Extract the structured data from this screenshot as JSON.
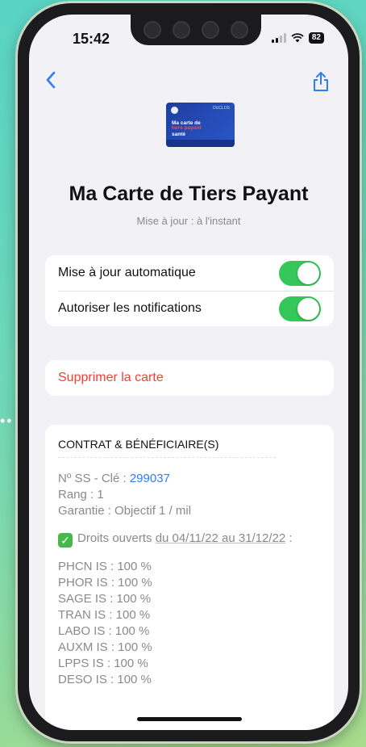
{
  "status_bar": {
    "time": "15:42",
    "battery": "82"
  },
  "nav": {
    "back_icon": "chevron-left-icon",
    "share_icon": "share-icon"
  },
  "card": {
    "logo": "DUCLOS",
    "line1": "Ma carte de",
    "line2": "tiers payant",
    "line3": "santé",
    "title": "Ma Carte de Tiers Payant",
    "subtitle": "Mise à jour : à l'instant"
  },
  "settings": {
    "auto_update": {
      "label": "Mise à jour automatique",
      "enabled": true
    },
    "notifications": {
      "label": "Autoriser les notifications",
      "enabled": true
    }
  },
  "delete": {
    "label": "Supprimer la carte"
  },
  "details": {
    "header": "CONTRAT & BÉNÉFICIAIRE(S)",
    "ss_label": "Nº SS - Clé :",
    "ss_value": "299037",
    "rang": "Rang : 1",
    "garantie": "Garantie : Objectif 1 / mil",
    "droits_prefix": "Droits ouverts",
    "droits_dates": "du 04/11/22 au 31/12/22",
    "droits_suffix": ":",
    "coverage": [
      "PHCN IS : 100 %",
      "PHOR IS : 100 %",
      "SAGE IS : 100 %",
      "TRAN IS : 100 %",
      "LABO IS : 100 %",
      "AUXM IS : 100 %",
      "LPPS IS : 100 %",
      "DESO IS : 100 %"
    ]
  },
  "colors": {
    "accent": "#2f7cf6",
    "toggle_on": "#34c759",
    "destructive": "#ff3b30",
    "background": "#f1f1f6"
  }
}
